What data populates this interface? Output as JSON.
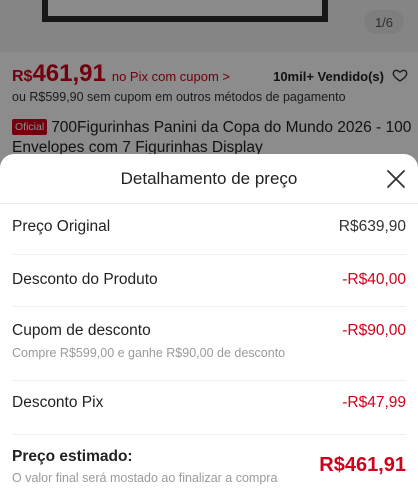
{
  "product": {
    "page_indicator": "1/6",
    "price_currency": "R$",
    "price_value": "461,91",
    "pix_label": "no Pix com cupom >",
    "sold_count": "10mil+ Vendido(s)",
    "alt_price_text": "ou R$599,90 sem cupom em outros métodos de pagamento",
    "official_badge": "Oficial",
    "title": "700Figurinhas Panini da Copa do Mundo 2026 - 100 Envelopes com 7 Figurinhas Display"
  },
  "sheet": {
    "title": "Detalhamento de preço",
    "items": [
      {
        "label": "Preço Original",
        "value": "R$639,90"
      },
      {
        "label": "Desconto do Produto",
        "value": "-R$40,00"
      },
      {
        "label": "Cupom de desconto",
        "sub": "Compre R$599,00 e ganhe R$90,00 de desconto",
        "value": "-R$90,00"
      },
      {
        "label": "Desconto Pix",
        "value": "-R$47,99"
      }
    ],
    "total": {
      "label": "Preço estimado:",
      "sub": "O valor final será mostado ao finalizar a compra",
      "value": "R$461,91"
    }
  },
  "colors": {
    "accent": "#d0011b",
    "overlay": "rgba(0,0,0,0.45)"
  }
}
